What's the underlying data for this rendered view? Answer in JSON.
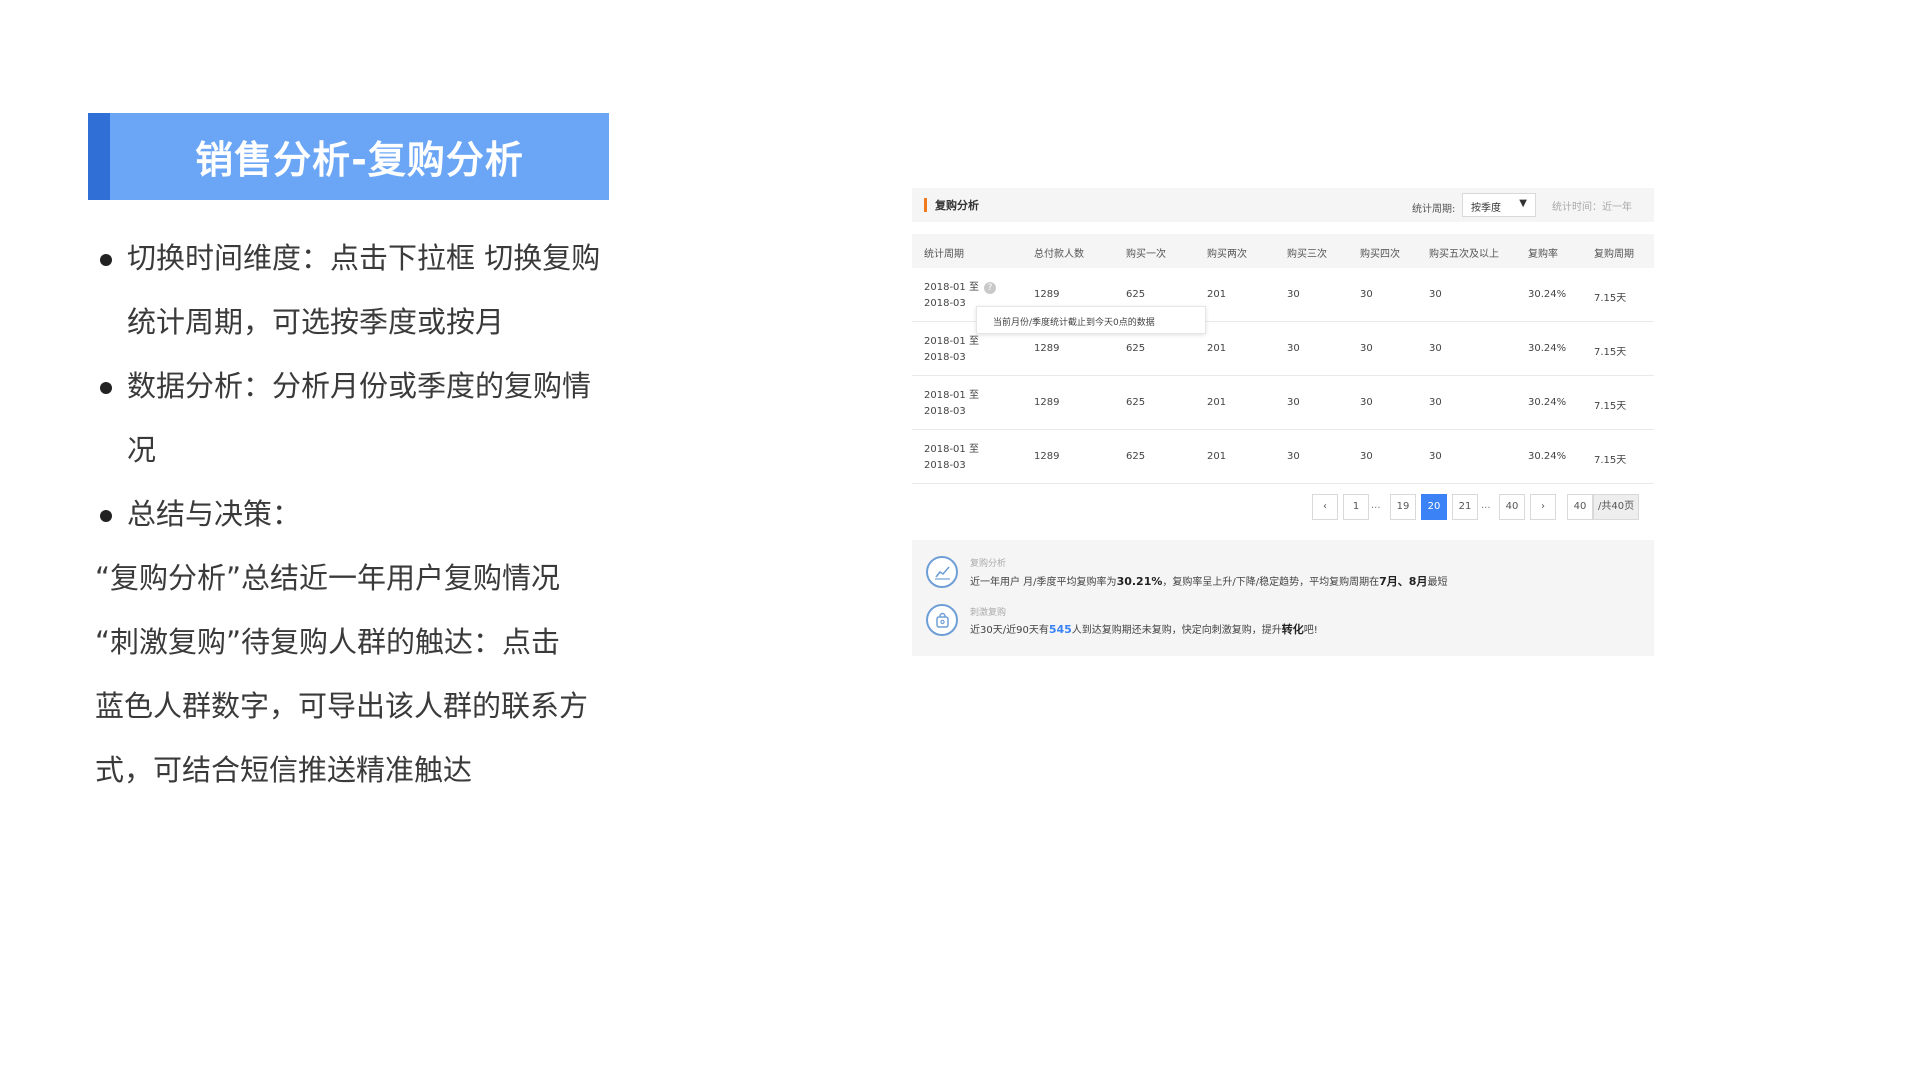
{
  "slide": {
    "title": "销售分析-复购分析",
    "bullets": [
      {
        "first": "切换时间维度：点击下拉框 切换复购",
        "second": "统计周期，可选按季度或按月"
      },
      {
        "first": "数据分析：分析月份或季度的复购情",
        "second": "况"
      },
      {
        "first": "总结与决策："
      }
    ],
    "paragraph": [
      "“复购分析”总结近一年用户复购情况",
      "“刺激复购”待复购人群的触达：点击",
      "蓝色人群数字，可导出该人群的联系方",
      "式，可结合短信推送精准触达"
    ]
  },
  "panel": {
    "title": "复购分析",
    "period_label": "统计周期:",
    "period_value": "按季度",
    "time_label": "统计时间：近一年",
    "accent_color": "#f07a1e",
    "columns": [
      "统计周期",
      "总付款人数",
      "购买一次",
      "购买两次",
      "购买三次",
      "购买四次",
      "购买五次及以上",
      "复购率",
      "复购周期"
    ],
    "rows": [
      {
        "period_start": "2018-01 至",
        "period_end": "2018-03",
        "payers": "1289",
        "once": "625",
        "twice": "201",
        "thrice": "30",
        "four": "30",
        "five_plus": "30",
        "rate": "30.24%",
        "cycle": "7.15天"
      },
      {
        "period_start": "2018-01 至",
        "period_end": "2018-03",
        "payers": "1289",
        "once": "625",
        "twice": "201",
        "thrice": "30",
        "four": "30",
        "five_plus": "30",
        "rate": "30.24%",
        "cycle": "7.15天"
      },
      {
        "period_start": "2018-01 至",
        "period_end": "2018-03",
        "payers": "1289",
        "once": "625",
        "twice": "201",
        "thrice": "30",
        "four": "30",
        "five_plus": "30",
        "rate": "30.24%",
        "cycle": "7.15天"
      },
      {
        "period_start": "2018-01 至",
        "period_end": "2018-03",
        "payers": "1289",
        "once": "625",
        "twice": "201",
        "thrice": "30",
        "four": "30",
        "five_plus": "30",
        "rate": "30.24%",
        "cycle": "7.15天"
      }
    ],
    "help_mark": "?",
    "tooltip": "当前月份/季度统计截止到今天0点的数据",
    "pagination": {
      "prev": "‹",
      "next": "›",
      "pages": [
        "1",
        "19",
        "20",
        "21",
        "40"
      ],
      "active": "20",
      "ellipsis": "...",
      "jump_value": "40",
      "total": "/共40页"
    },
    "summary": {
      "repurchase": {
        "label": "复购分析",
        "text_a": "近一年用户 月/季度平均复购率为",
        "rate": "30.21%",
        "text_b": "，复购率呈上升/下降/稳定趋势，平均复购周期在",
        "months": "7月、8月",
        "text_c": "最短"
      },
      "stimulate": {
        "label": "刺激复购",
        "text_a": "近30天/近90天有",
        "count": "545",
        "text_b": "人到达复购期还未复购，快定向刺激复购，提升",
        "emphasis": "转化",
        "text_c": "吧!"
      }
    }
  }
}
